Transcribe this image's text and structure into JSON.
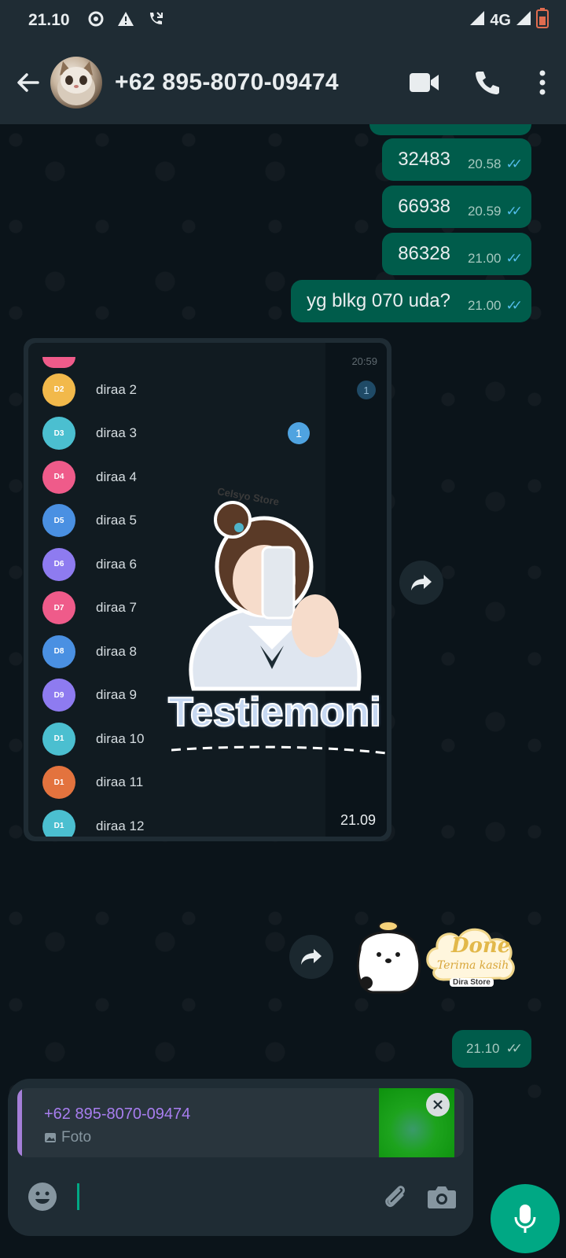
{
  "status_bar": {
    "time": "21.10",
    "network": "4G",
    "icons": [
      "location-icon",
      "warning-icon",
      "missed-call-icon",
      "signal-icon",
      "battery-icon"
    ]
  },
  "header": {
    "contact_name": "+62 895-8070-09474",
    "icons": [
      "back-arrow-icon",
      "video-call-icon",
      "phone-icon",
      "more-vert-icon"
    ]
  },
  "messages": [
    {
      "text": "32483",
      "time": "20.58",
      "status": "read"
    },
    {
      "text": "66938",
      "time": "20.59",
      "status": "read"
    },
    {
      "text": "86328",
      "time": "21.00",
      "status": "read"
    },
    {
      "text": "yg blkg 070 uda?",
      "time": "21.00",
      "status": "read"
    }
  ],
  "image_message": {
    "time": "21.09",
    "overlay_text": "Testiemoni",
    "overlay_sub": "Celsyo Store",
    "side_time": "20:59",
    "side_badge": "1",
    "list": [
      {
        "initials": "D2",
        "name": "diraa 2",
        "color": "#f2b94b",
        "badge": ""
      },
      {
        "initials": "D3",
        "name": "diraa 3",
        "color": "#4bbfd0",
        "badge": "1"
      },
      {
        "initials": "D4",
        "name": "diraa 4",
        "color": "#ef5b8a",
        "badge": ""
      },
      {
        "initials": "D5",
        "name": "diraa 5",
        "color": "#4a90e2",
        "badge": ""
      },
      {
        "initials": "D6",
        "name": "diraa 6",
        "color": "#8e7bf0",
        "badge": ""
      },
      {
        "initials": "D7",
        "name": "diraa 7",
        "color": "#ef5b8a",
        "badge": ""
      },
      {
        "initials": "D8",
        "name": "diraa 8",
        "color": "#4a90e2",
        "badge": ""
      },
      {
        "initials": "D9",
        "name": "diraa 9",
        "color": "#8e7bf0",
        "badge": ""
      },
      {
        "initials": "D1",
        "name": "diraa 10",
        "color": "#4bbfd0",
        "badge": ""
      },
      {
        "initials": "D1",
        "name": "diraa 11",
        "color": "#e3733e",
        "badge": ""
      },
      {
        "initials": "D1",
        "name": "diraa 12",
        "color": "#4bbfd0",
        "badge": ""
      }
    ]
  },
  "sticker_message": {
    "sticker_text": "Done",
    "sticker_sub": "Terima kasih",
    "sticker_brand": "Dira Store"
  },
  "last_status": {
    "time": "21.10",
    "status": "delivered"
  },
  "composer": {
    "reply_name": "+62 895-8070-09474",
    "reply_type": "Foto",
    "input_value": ""
  }
}
